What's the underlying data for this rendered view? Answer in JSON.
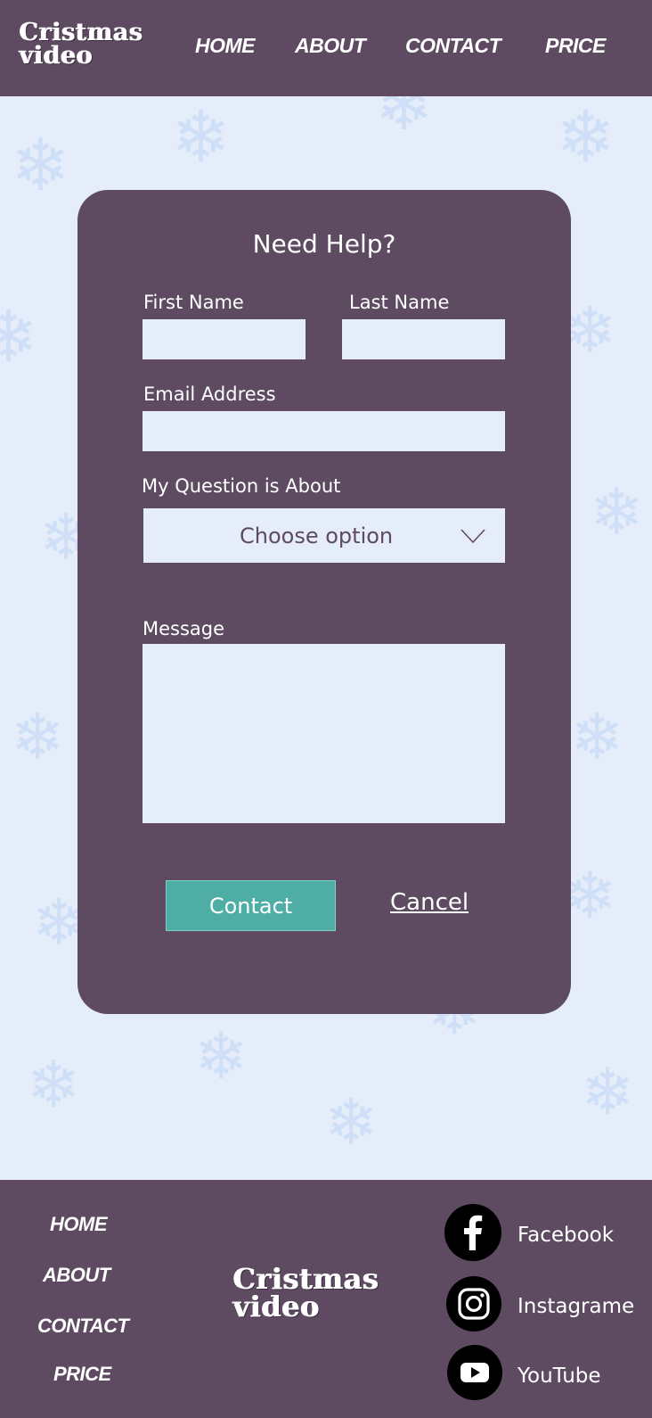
{
  "brand": {
    "line1": "Cristmas",
    "line2": "video"
  },
  "nav": [
    "HOME",
    "ABOUT",
    "CONTACT",
    "PRICE"
  ],
  "form": {
    "title": "Need Help?",
    "first_name_label": "First Name",
    "first_name_value": "",
    "last_name_label": "Last Name",
    "last_name_value": "",
    "email_label": "Email Address",
    "email_value": "",
    "question_label": "My Question is About",
    "question_selected": "Choose option",
    "message_label": "Message",
    "message_value": "",
    "contact_button": "Contact",
    "cancel_link": "Cancel"
  },
  "footer": {
    "nav": [
      "HOME",
      "ABOUT",
      "CONTACT",
      "PRICE"
    ],
    "brand": {
      "line1": "Cristmas",
      "line2": "video"
    },
    "social": [
      {
        "label": "Facebook",
        "icon": "facebook-icon"
      },
      {
        "label": "Instagrame",
        "icon": "instagram-icon"
      },
      {
        "label": "YouTube",
        "icon": "youtube-icon"
      }
    ]
  },
  "colors": {
    "header_bg": "#5e4b62",
    "page_bg": "#e4edf9",
    "snowflake": "#cfdff7",
    "contact_button": "#4eaea6"
  }
}
